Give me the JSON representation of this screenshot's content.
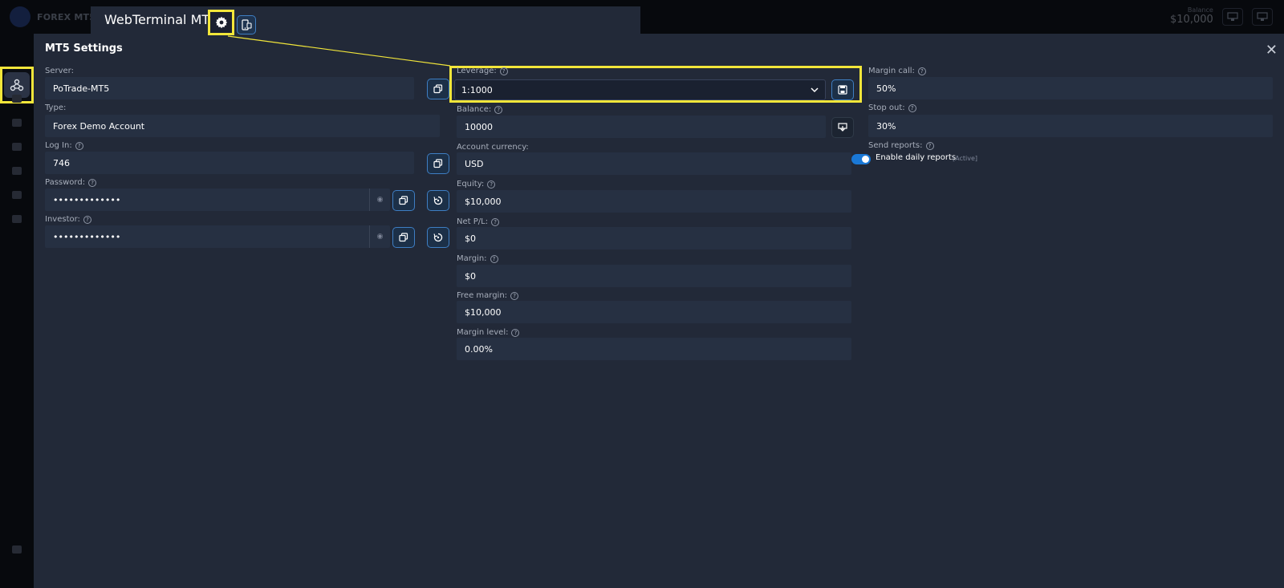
{
  "app": {
    "brand": "FOREX MT5 D",
    "top_balance_label": "Balance",
    "top_balance_value": "$10,000"
  },
  "titlebar": {
    "title": "WebTerminal MT5"
  },
  "panel": {
    "title": "MT5 Settings",
    "close_label": "✕"
  },
  "left_column": {
    "server_label": "Server:",
    "server_value": "PoTrade-MT5",
    "type_label": "Type:",
    "type_value": "Forex Demo Account",
    "login_label": "Log In:",
    "login_value": "746",
    "password_label": "Password:",
    "password_value": "•••••••••••••",
    "investor_label": "Investor:",
    "investor_value": "•••••••••••••"
  },
  "middle_column": {
    "leverage_label": "Leverage:",
    "leverage_value": "1:1000",
    "balance_label": "Balance:",
    "balance_value": "10000",
    "currency_label": "Account currency:",
    "currency_value": "USD",
    "equity_label": "Equity:",
    "equity_value": "$10,000",
    "netpl_label": "Net P/L:",
    "netpl_value": "$0",
    "margin_label": "Margin:",
    "margin_value": "$0",
    "free_margin_label": "Free margin:",
    "free_margin_value": "$10,000",
    "margin_level_label": "Margin level:",
    "margin_level_value": "0.00%"
  },
  "right_column": {
    "margin_call_label": "Margin call:",
    "margin_call_value": "50%",
    "stop_out_label": "Stop out:",
    "stop_out_value": "30%",
    "send_reports_label": "Send reports:",
    "daily_reports_label": "Enable daily reports",
    "daily_reports_status": "[Active]",
    "daily_reports_enabled": true
  },
  "icons": {
    "help": "?",
    "eye": "◉"
  },
  "colors": {
    "highlight": "#f2e63a",
    "accent": "#1a78d6",
    "panel_bg": "#222938",
    "field_bg": "#263042"
  }
}
